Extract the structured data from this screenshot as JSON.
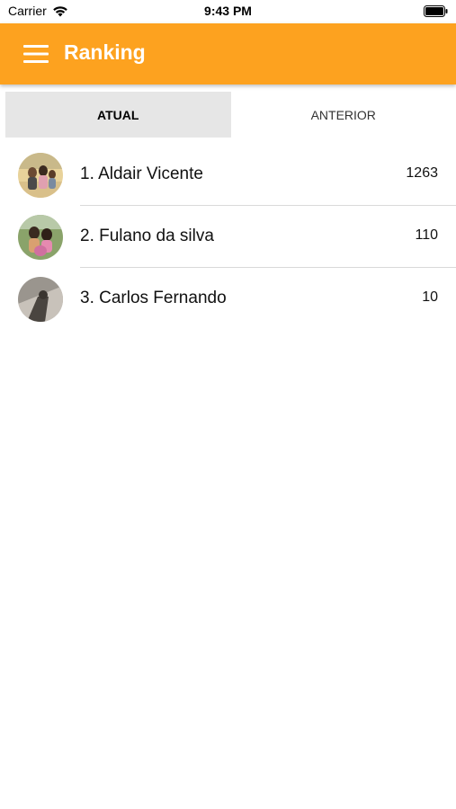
{
  "status_bar": {
    "carrier": "Carrier",
    "time": "9:43 PM",
    "wifi_icon": "wifi-icon",
    "battery_icon": "battery-icon"
  },
  "app_bar": {
    "title": "Ranking",
    "menu_icon": "hamburger-menu-icon",
    "background_color": "#fda21f"
  },
  "tabs": [
    {
      "label": "ATUAL",
      "active": true
    },
    {
      "label": "ANTERIOR",
      "active": false
    }
  ],
  "ranking": [
    {
      "name": "1. Aldair Vicente",
      "score": "1263",
      "avatar_icon": "user-photo-avatar"
    },
    {
      "name": "2. Fulano da silva",
      "score": "110",
      "avatar_icon": "user-photo-avatar"
    },
    {
      "name": "3. Carlos Fernando",
      "score": "10",
      "avatar_icon": "user-photo-avatar"
    }
  ]
}
